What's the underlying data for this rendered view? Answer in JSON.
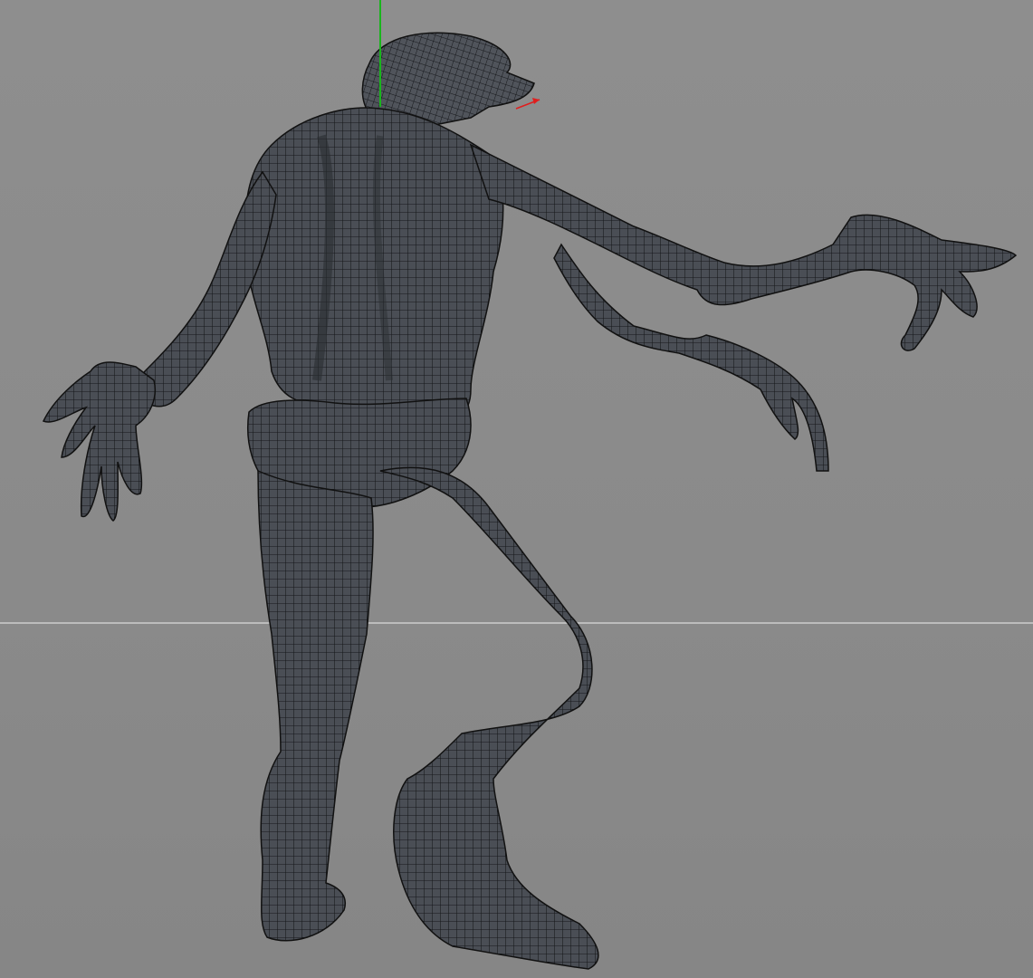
{
  "viewport": {
    "view_type": "perspective-3d",
    "model": "creature-mesh",
    "display_mode": "wireframe-over-shaded",
    "colors": {
      "background_top": "#8e8e8e",
      "background_bottom": "#868686",
      "horizon_line": "#c4c4c4",
      "mesh_fill": "#4a4e55",
      "mesh_wire": "#15171a",
      "axis_y": "#19b51c",
      "axis_x": "#e01e1e"
    },
    "icons": [
      "axis-gizmo-icon"
    ]
  }
}
